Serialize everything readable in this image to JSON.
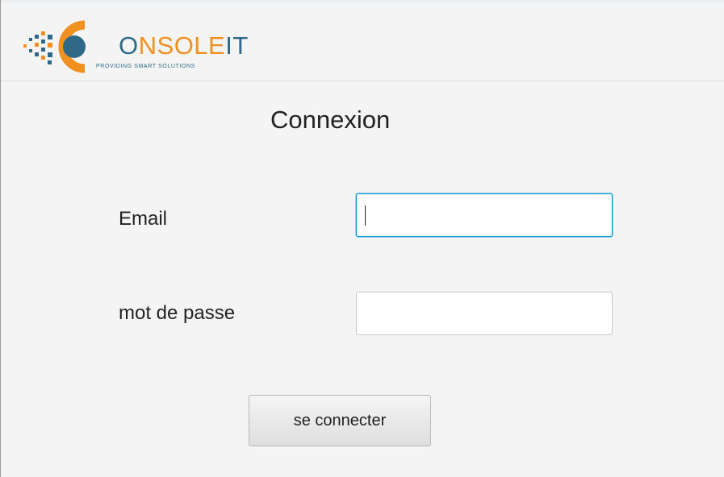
{
  "logo": {
    "letter_c": "C",
    "wordmark_part1": "O",
    "wordmark_part2": "NSOLE",
    "wordmark_part3": "IT",
    "tagline": "PROVIDING SMART SOLUTIONS",
    "colors": {
      "blue": "#2e6a88",
      "orange": "#f0901e"
    }
  },
  "form": {
    "title": "Connexion",
    "email_label": "Email",
    "email_value": "",
    "password_label": "mot de passe",
    "password_value": "",
    "submit_label": "se connecter"
  },
  "colors": {
    "focus_border": "#1a9bd7",
    "background": "#f4f4f4"
  }
}
